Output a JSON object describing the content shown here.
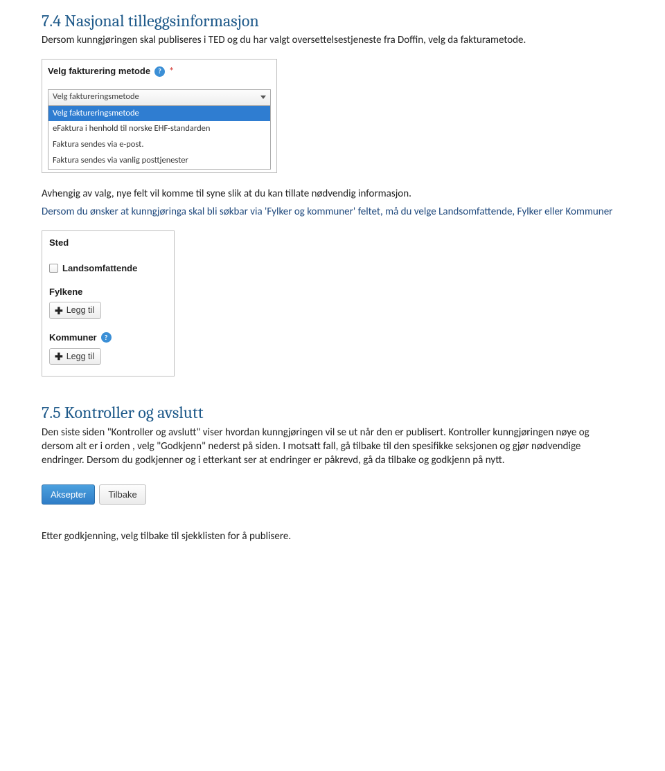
{
  "section74": {
    "heading": "7.4 Nasjonal tilleggsinformasjon",
    "para1": "Dersom kunngjøringen skal publiseres i TED og du har valgt oversettelsestjeneste fra Doffin, velg da fakturametode.",
    "widget": {
      "label": "Velg fakturering metode",
      "required_marker": "*",
      "selected": "Velg faktureringsmetode",
      "options": [
        "Velg faktureringsmetode",
        "eFaktura i henhold til norske EHF-standarden",
        "Faktura sendes via e-post.",
        "Faktura sendes via vanlig posttjenester"
      ]
    },
    "para2": "Avhengig av valg, nye felt vil komme til syne slik at du kan tillate nødvendig informasjon.",
    "para3": "Dersom du ønsker at kunngjøringa skal bli søkbar via 'Fylker og kommuner' feltet, må du velge Landsomfattende, Fylker eller Kommuner",
    "sted": {
      "title": "Sted",
      "landsomfattende_label": "Landsomfattende",
      "fylkene_label": "Fylkene",
      "kommuner_label": "Kommuner",
      "leggtil_label": "Legg til"
    }
  },
  "section75": {
    "heading": "7.5 Kontroller og avslutt",
    "para1": "Den siste siden \"Kontroller og avslutt\" viser hvordan kunngjøringen vil se ut når den er publisert. Kontroller kunngjøringen nøye og dersom alt er i orden , velg \"Godkjenn\" nederst på  siden.  I motsatt fall, gå tilbake til den spesifikke seksjonen og gjør nødvendige endringer. Dersom du godkjenner og i etterkant ser at endringer er påkrevd, gå da tilbake og godkjenn på nytt.",
    "btn_accept": "Aksepter",
    "btn_back": "Tilbake",
    "para2": "Etter godkjenning, velg tilbake til sjekklisten for å publisere."
  }
}
